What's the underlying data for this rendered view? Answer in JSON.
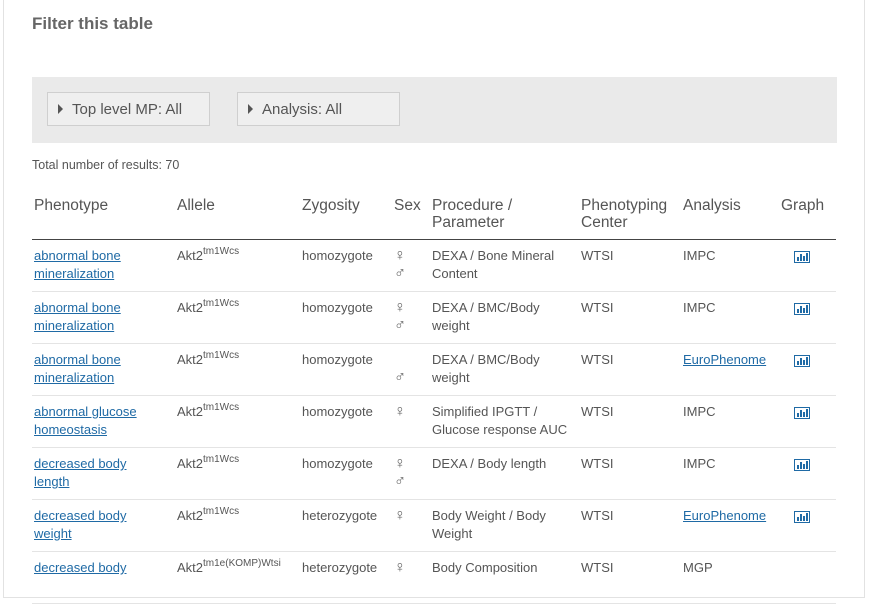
{
  "filter": {
    "title": "Filter this table",
    "buttons": [
      {
        "label": "Top level MP: All"
      },
      {
        "label": "Analysis: All"
      }
    ]
  },
  "results": {
    "total_label": "Total number of results: 70"
  },
  "table": {
    "headers": {
      "phenotype": "Phenotype",
      "allele": "Allele",
      "zygosity": "Zygosity",
      "sex": "Sex",
      "procedure_line1": "Procedure /",
      "procedure_line2": "Parameter",
      "center_line1": "Phenotyping",
      "center_line2": "Center",
      "analysis": "Analysis",
      "graph": "Graph"
    },
    "rows": [
      {
        "phenotype_l1": "abnormal bone",
        "phenotype_l2": "mineralization",
        "allele_base": "Akt2",
        "allele_sup": "tm1Wcs",
        "zygosity": "homozygote",
        "female": "♀",
        "male": "♂",
        "proc_l1": "DEXA / Bone Mineral",
        "proc_l2": "Content",
        "center": "WTSI",
        "analysis": "IMPC",
        "graph_icon": "bar-chart-icon"
      },
      {
        "phenotype_l1": "abnormal bone",
        "phenotype_l2": "mineralization",
        "allele_base": "Akt2",
        "allele_sup": "tm1Wcs",
        "zygosity": "homozygote",
        "female": "♀",
        "male": "♂",
        "proc_l1": "DEXA / BMC/Body",
        "proc_l2": "weight",
        "center": "WTSI",
        "analysis": "IMPC",
        "graph_icon": "bar-chart-icon"
      },
      {
        "phenotype_l1": "abnormal bone",
        "phenotype_l2": "mineralization",
        "allele_base": "Akt2",
        "allele_sup": "tm1Wcs",
        "zygosity": "homozygote",
        "female": "",
        "male": "♂",
        "proc_l1": "DEXA / BMC/Body",
        "proc_l2": "weight",
        "center": "WTSI",
        "analysis": "EuroPhenome",
        "graph_icon": "bar-chart-icon"
      },
      {
        "phenotype_l1": "abnormal glucose",
        "phenotype_l2": "homeostasis",
        "allele_base": "Akt2",
        "allele_sup": "tm1Wcs",
        "zygosity": "homozygote",
        "female": "♀",
        "male": "",
        "proc_l1": "Simplified IPGTT /",
        "proc_l2": "Glucose response AUC",
        "center": "WTSI",
        "analysis": "IMPC",
        "graph_icon": "bar-chart-icon"
      },
      {
        "phenotype_l1": "decreased body",
        "phenotype_l2": "length",
        "allele_base": "Akt2",
        "allele_sup": "tm1Wcs",
        "zygosity": "homozygote",
        "female": "♀",
        "male": "♂",
        "proc_l1": "DEXA / Body length",
        "proc_l2": "",
        "center": "WTSI",
        "analysis": "IMPC",
        "graph_icon": "bar-chart-icon"
      },
      {
        "phenotype_l1": "decreased body",
        "phenotype_l2": "weight",
        "allele_base": "Akt2",
        "allele_sup": "tm1Wcs",
        "zygosity": "heterozygote",
        "female": "♀",
        "male": "",
        "proc_l1": "Body Weight / Body",
        "proc_l2": "Weight",
        "center": "WTSI",
        "analysis": "EuroPhenome",
        "graph_icon": "bar-chart-icon"
      },
      {
        "phenotype_l1": "decreased body",
        "phenotype_l2": "",
        "allele_base": "Akt2",
        "allele_sup": "tm1e(KOMP)Wtsi",
        "zygosity": "heterozygote",
        "female": "♀",
        "male": "",
        "proc_l1": "Body Composition",
        "proc_l2": "",
        "center": "WTSI",
        "analysis": "MGP",
        "graph_icon": ""
      }
    ]
  },
  "colors": {
    "link": "#1f6aa5",
    "filter_bg": "#eaeaea",
    "text": "#555555"
  }
}
